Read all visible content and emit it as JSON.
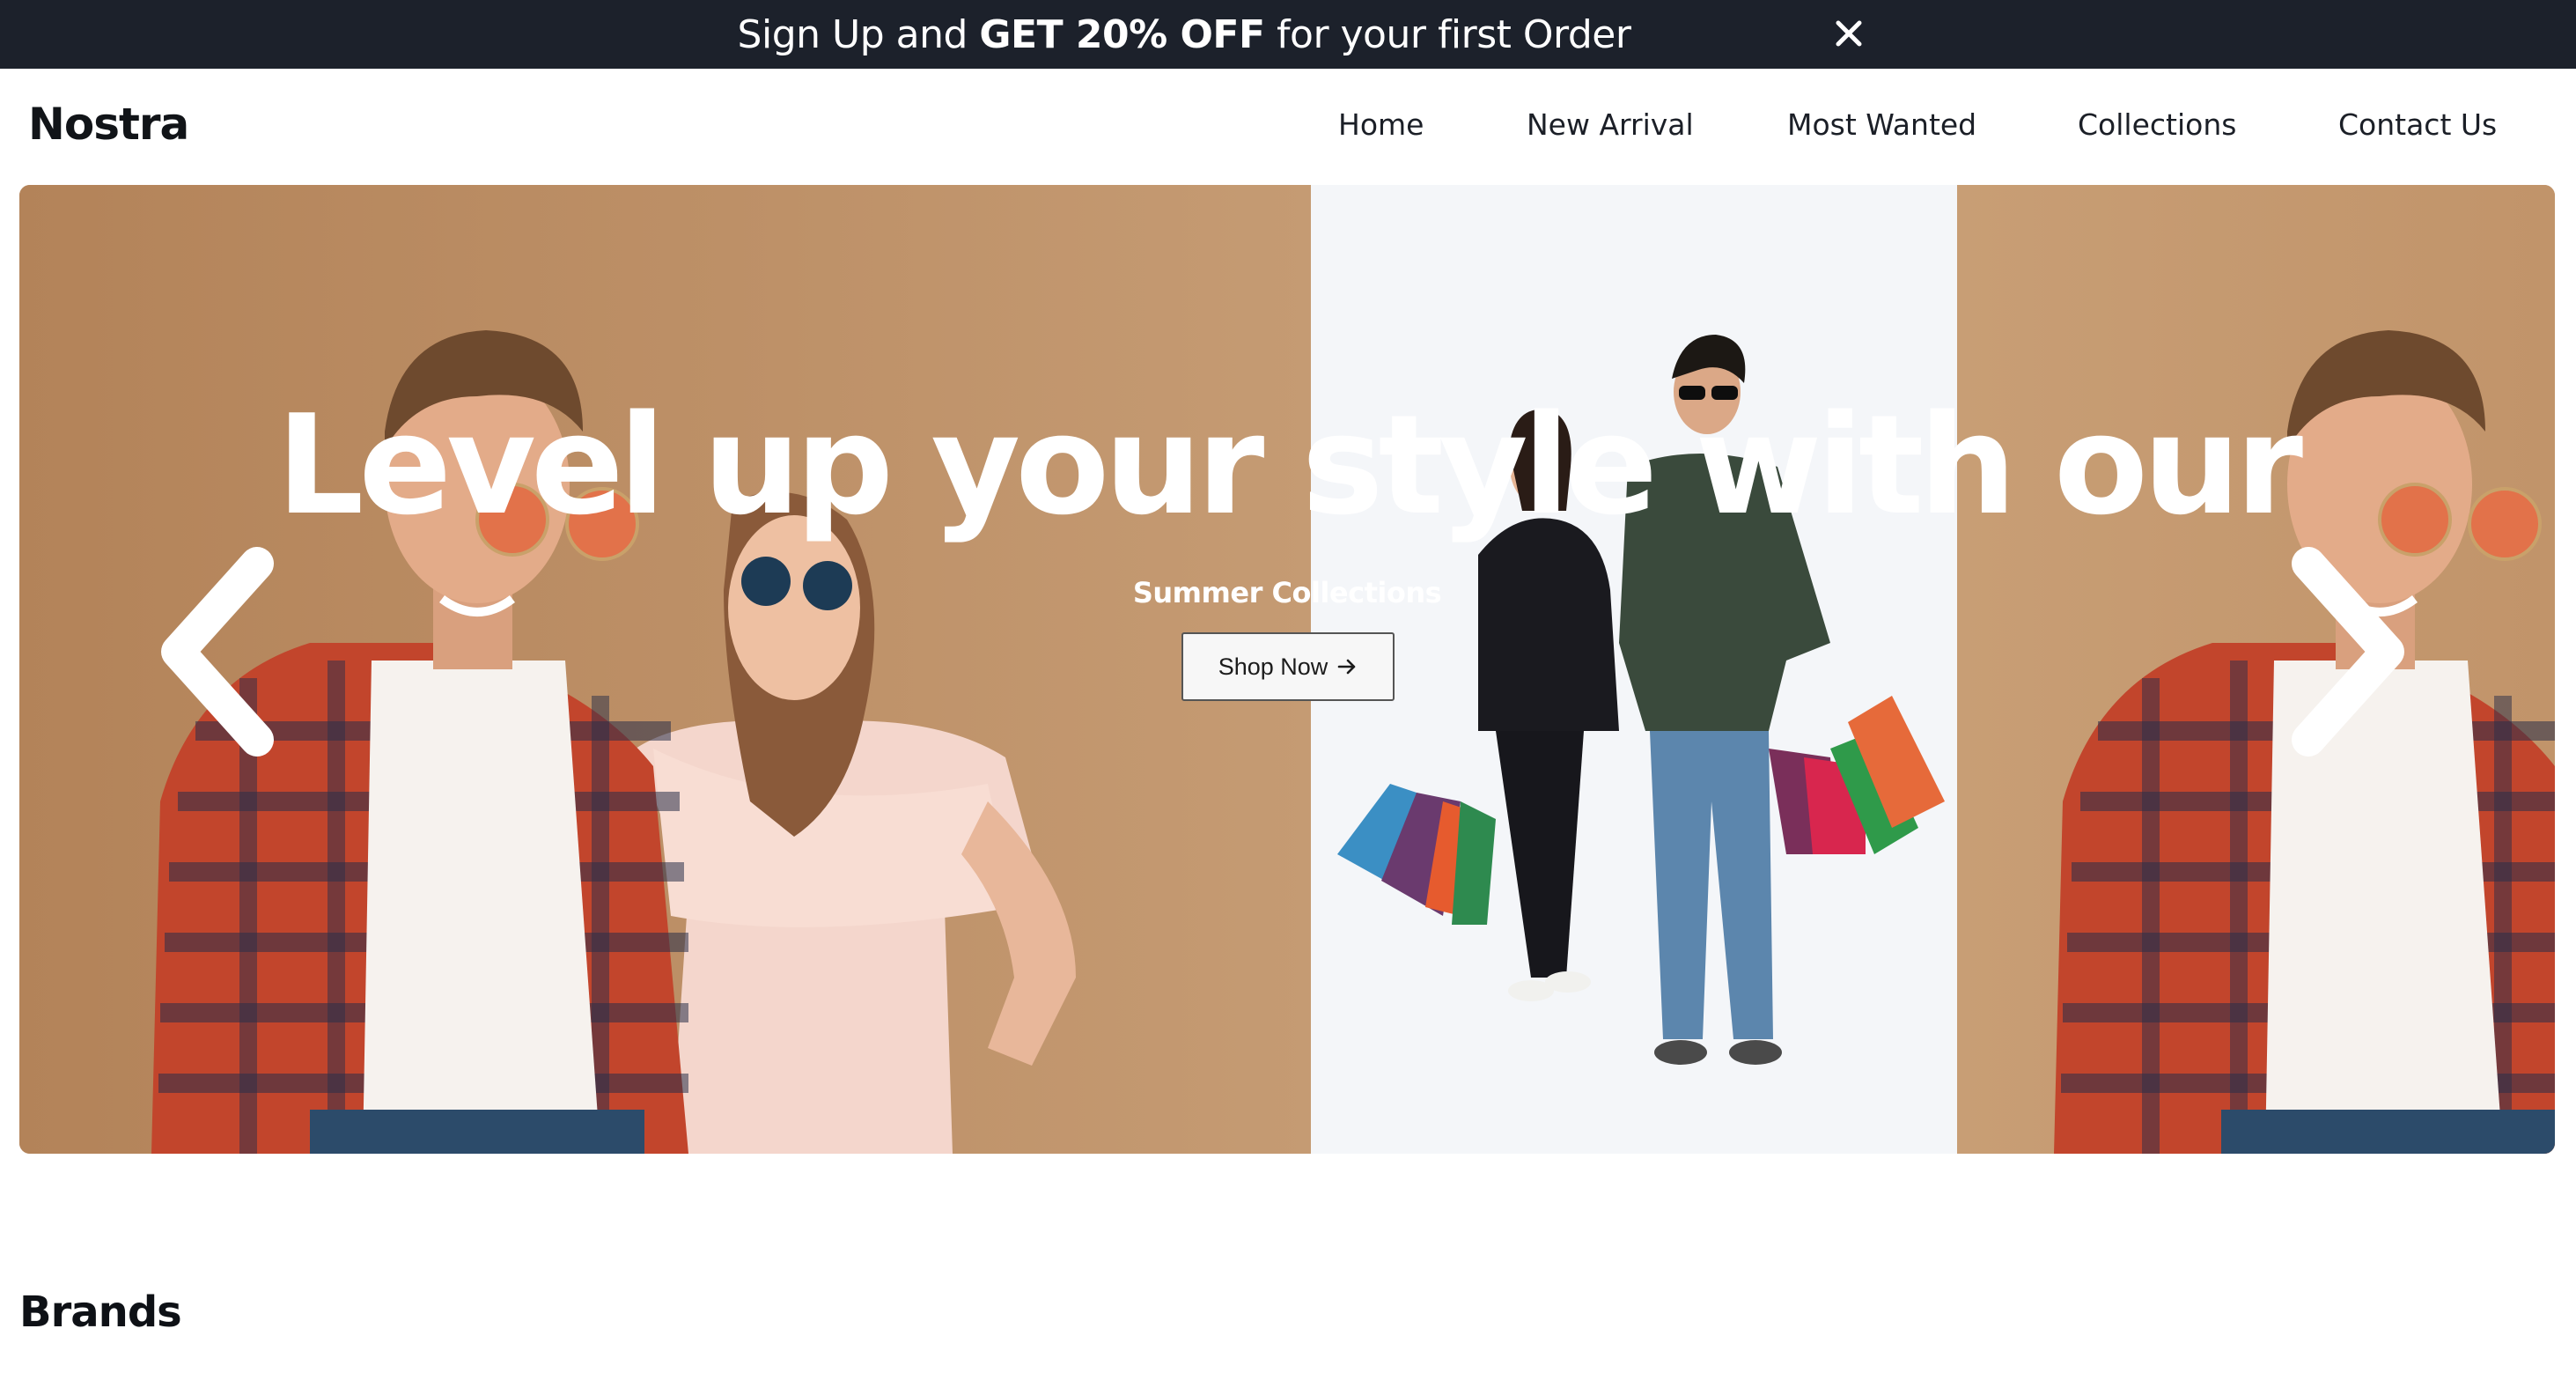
{
  "announcement": {
    "prefix": "Sign Up and ",
    "highlight": "GET 20% OFF",
    "suffix": " for your first Order",
    "close_icon": "close-icon",
    "background": "#1c212b"
  },
  "navbar": {
    "logo": "Nostra",
    "links": [
      "Home",
      "New Arrival",
      "Most Wanted",
      "Collections",
      "Contact Us"
    ]
  },
  "hero": {
    "title": "Level up your style with our",
    "subtitle": "Summer Collections",
    "cta_label": "Shop Now",
    "cta_icon": "arrow-right-icon",
    "prev_icon": "chevron-left-icon",
    "next_icon": "chevron-right-icon",
    "panel_colors": [
      "#b38359",
      "#f4f6f9",
      "#c89e75"
    ]
  },
  "brands": {
    "title": "Brands"
  }
}
